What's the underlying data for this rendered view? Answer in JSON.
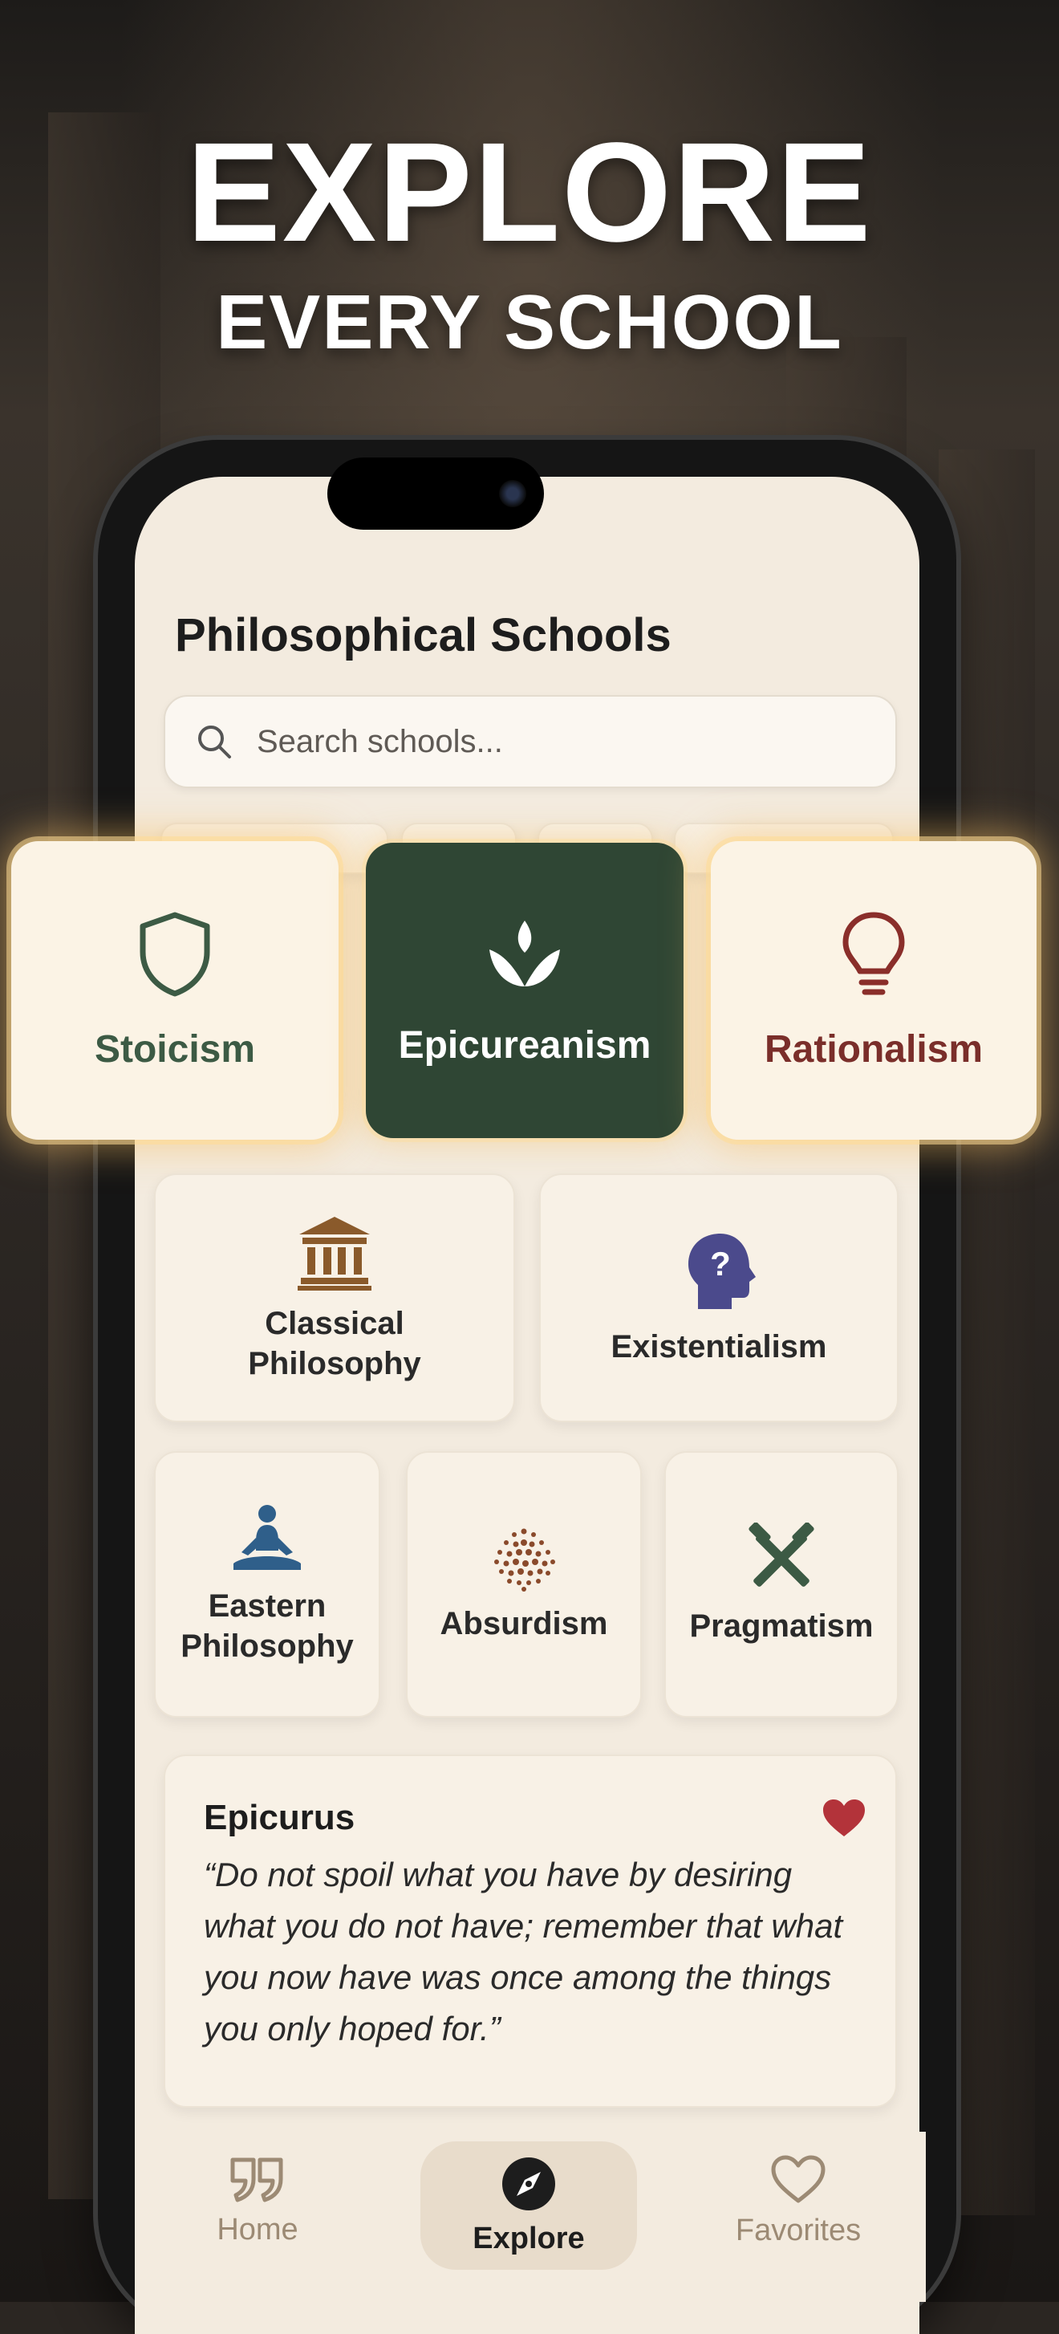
{
  "headline": {
    "line1": "EXPLORE",
    "line2": "EVERY SCHOOL"
  },
  "screen": {
    "title": "Philosophical Schools",
    "search": {
      "placeholder": "Search schools...",
      "icon": "search-icon"
    },
    "highlight_cards": [
      {
        "label": "Stoicism",
        "icon": "shield-icon",
        "color": "#3c5a44",
        "selected": false
      },
      {
        "label": "Epicureanism",
        "icon": "lotus-icon",
        "color": "#ffffff",
        "selected": true
      },
      {
        "label": "Rationalism",
        "icon": "lightbulb-icon",
        "color": "#8a2e2a",
        "selected": false
      }
    ],
    "grid_row1": [
      {
        "label": "Classical Philosophy",
        "icon": "temple-icon",
        "color": "#8a5a2b"
      },
      {
        "label": "Existentialism",
        "icon": "head-question-icon",
        "color": "#4b4a8c"
      }
    ],
    "grid_row2": [
      {
        "label": "Eastern Philosophy",
        "icon": "meditation-icon",
        "color": "#2f5f8a"
      },
      {
        "label": "Absurdism",
        "icon": "dots-pattern-icon",
        "color": "#8a4a2b"
      },
      {
        "label": "Pragmatism",
        "icon": "tools-icon",
        "color": "#3c5a44"
      }
    ],
    "quote": {
      "author": "Epicurus",
      "text": "“Do not spoil what you have by desiring what you do not have; remember that what you now have was once among the things you only hoped for.”",
      "favorited": true
    },
    "tabs": [
      {
        "label": "Home",
        "icon": "quote-marks-icon",
        "active": false
      },
      {
        "label": "Explore",
        "icon": "compass-icon",
        "active": true
      },
      {
        "label": "Favorites",
        "icon": "heart-outline-icon",
        "active": false
      }
    ]
  },
  "colors": {
    "accent_green": "#2f4634",
    "heart_red": "#b3333a",
    "paper": "#f3ebdf"
  }
}
